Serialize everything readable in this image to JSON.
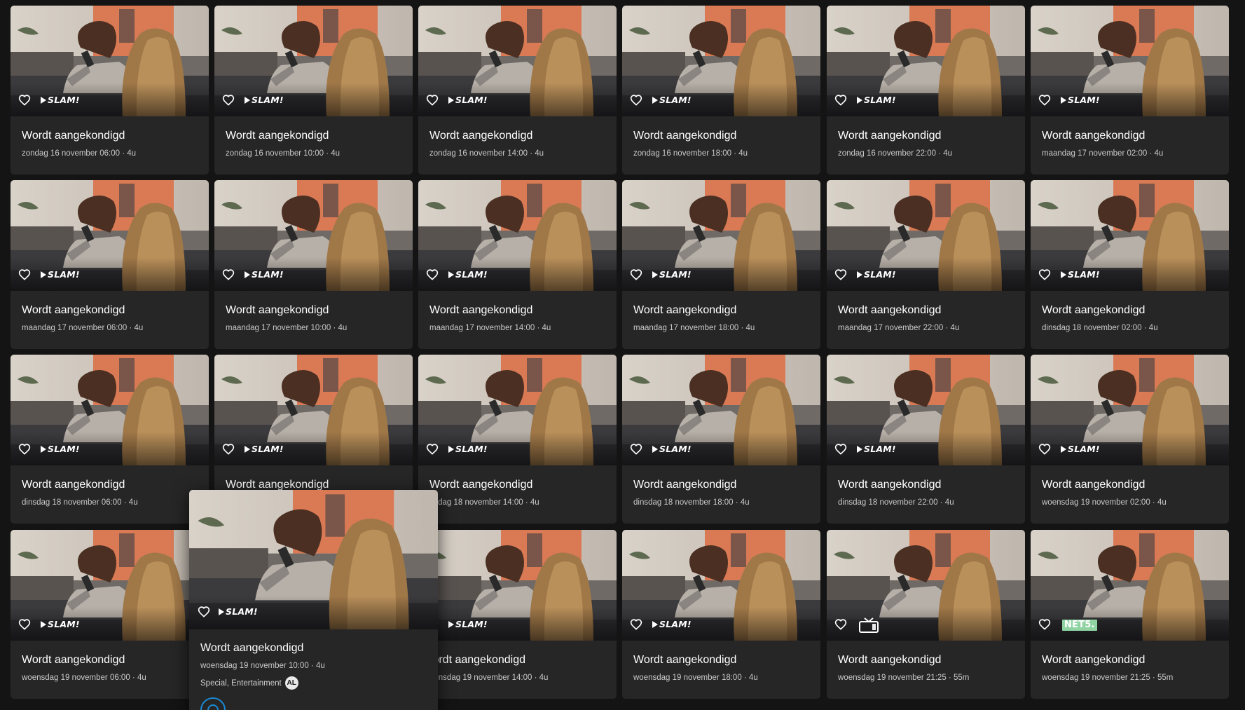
{
  "cards": [
    {
      "title": "Wordt aangekondigd",
      "meta": "zondag 16 november 06:00 · 4u",
      "channel": "SLAM!"
    },
    {
      "title": "Wordt aangekondigd",
      "meta": "zondag 16 november 10:00 · 4u",
      "channel": "SLAM!"
    },
    {
      "title": "Wordt aangekondigd",
      "meta": "zondag 16 november 14:00 · 4u",
      "channel": "SLAM!"
    },
    {
      "title": "Wordt aangekondigd",
      "meta": "zondag 16 november 18:00 · 4u",
      "channel": "SLAM!"
    },
    {
      "title": "Wordt aangekondigd",
      "meta": "zondag 16 november 22:00 · 4u",
      "channel": "SLAM!"
    },
    {
      "title": "Wordt aangekondigd",
      "meta": "maandag 17 november 02:00 · 4u",
      "channel": "SLAM!"
    },
    {
      "title": "Wordt aangekondigd",
      "meta": "maandag 17 november 06:00 · 4u",
      "channel": "SLAM!"
    },
    {
      "title": "Wordt aangekondigd",
      "meta": "maandag 17 november 10:00 · 4u",
      "channel": "SLAM!"
    },
    {
      "title": "Wordt aangekondigd",
      "meta": "maandag 17 november 14:00 · 4u",
      "channel": "SLAM!"
    },
    {
      "title": "Wordt aangekondigd",
      "meta": "maandag 17 november 18:00 · 4u",
      "channel": "SLAM!"
    },
    {
      "title": "Wordt aangekondigd",
      "meta": "maandag 17 november 22:00 · 4u",
      "channel": "SLAM!"
    },
    {
      "title": "Wordt aangekondigd",
      "meta": "dinsdag 18 november 02:00 · 4u",
      "channel": "SLAM!"
    },
    {
      "title": "Wordt aangekondigd",
      "meta": "dinsdag 18 november 06:00 · 4u",
      "channel": "SLAM!"
    },
    {
      "title": "Wordt aangekondigd",
      "meta": "",
      "channel": "SLAM!"
    },
    {
      "title": "Wordt aangekondigd",
      "meta": "nsdag 18 november 14:00 · 4u",
      "channel": "SLAM!"
    },
    {
      "title": "Wordt aangekondigd",
      "meta": "dinsdag 18 november 18:00 · 4u",
      "channel": "SLAM!"
    },
    {
      "title": "Wordt aangekondigd",
      "meta": "dinsdag 18 november 22:00 · 4u",
      "channel": "SLAM!"
    },
    {
      "title": "Wordt aangekondigd",
      "meta": "woensdag 19 november 02:00 · 4u",
      "channel": "SLAM!"
    },
    {
      "title": "Wordt aangekondigd",
      "meta": "woensdag 19 november 06:00 · 4u",
      "channel": "SLAM!"
    },
    {
      "title": "",
      "meta": "",
      "channel": ""
    },
    {
      "title": "/ordt aangekondigd",
      "meta": "oensdag 19 november 14:00 · 4u",
      "channel": "SLAM!"
    },
    {
      "title": "Wordt aangekondigd",
      "meta": "woensdag 19 november 18:00 · 4u",
      "channel": "SLAM!"
    },
    {
      "title": "Wordt aangekondigd",
      "meta": "woensdag 19 november 21:25 · 55m",
      "channel": "tv-icon"
    },
    {
      "title": "Wordt aangekondigd",
      "meta": "woensdag 19 november 21:25 · 55m",
      "channel": "NET5."
    }
  ],
  "popup": {
    "title": "Wordt aangekondigd",
    "meta": "woensdag 19 november 10:00 · 4u",
    "genres": "Special, Entertainment",
    "age_rating": "AL",
    "channel": "SLAM!"
  },
  "colors": {
    "background": "#141414",
    "card": "#262626",
    "accent": "#1a8ad6",
    "net5": "#8fd3a3"
  }
}
